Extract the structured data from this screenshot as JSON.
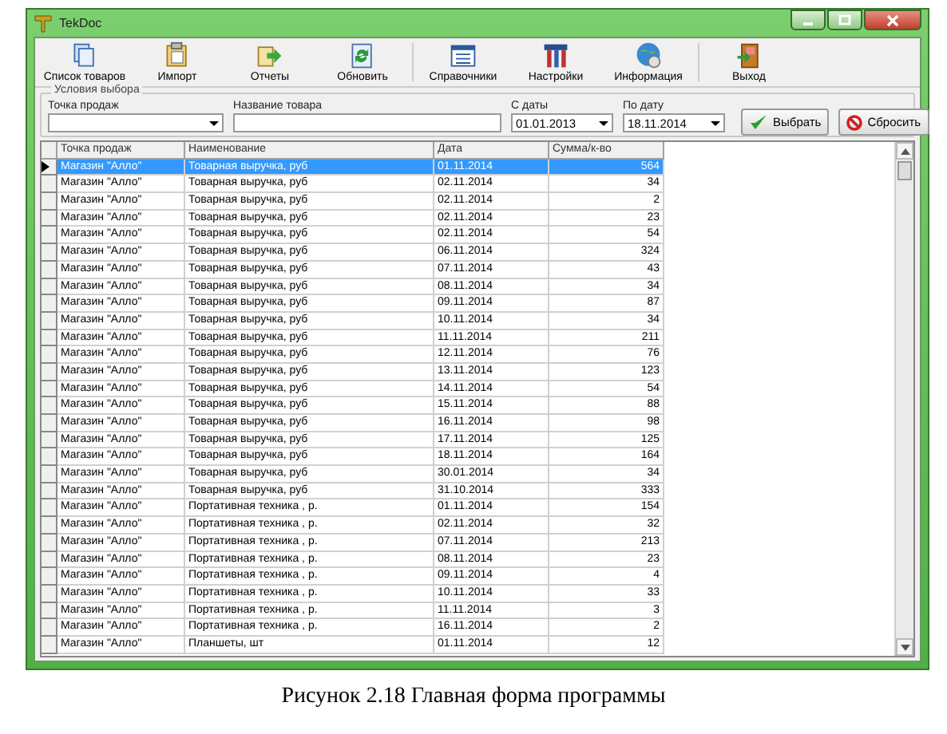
{
  "window": {
    "title": "TekDoc"
  },
  "toolbar": [
    {
      "label": "Список товаров",
      "kind": "list"
    },
    {
      "label": "Импорт",
      "kind": "import"
    },
    {
      "label": "Отчеты",
      "kind": "report"
    },
    {
      "label": "Обновить",
      "kind": "refresh"
    },
    {
      "label": "Справочники",
      "kind": "catalog"
    },
    {
      "label": "Настройки",
      "kind": "settings"
    },
    {
      "label": "Информация",
      "kind": "info"
    },
    {
      "label": "Выход",
      "kind": "exit"
    }
  ],
  "filter": {
    "title": "Условия выбора",
    "store_label": "Точка продаж",
    "product_label": "Название товара",
    "from_label": "С даты",
    "from_value": "01.01.2013",
    "to_label": "По дату",
    "to_value": "18.11.2014",
    "apply_button": "Выбрать",
    "reset_button": "Сбросить"
  },
  "table": {
    "columns": [
      "Точка продаж",
      "Наименование",
      "Дата",
      "Сумма/к-во"
    ],
    "rows": [
      {
        "cells": [
          "Магазин \"Алло\"",
          "Товарная выручка, руб",
          "01.11.2014",
          "564"
        ],
        "selected": true
      },
      {
        "cells": [
          "Магазин \"Алло\"",
          "Товарная выручка, руб",
          "02.11.2014",
          "34"
        ],
        "selected": false
      },
      {
        "cells": [
          "Магазин \"Алло\"",
          "Товарная выручка, руб",
          "02.11.2014",
          "2"
        ],
        "selected": false
      },
      {
        "cells": [
          "Магазин \"Алло\"",
          "Товарная выручка, руб",
          "02.11.2014",
          "23"
        ],
        "selected": false
      },
      {
        "cells": [
          "Магазин \"Алло\"",
          "Товарная выручка, руб",
          "02.11.2014",
          "54"
        ],
        "selected": false
      },
      {
        "cells": [
          "Магазин \"Алло\"",
          "Товарная выручка, руб",
          "06.11.2014",
          "324"
        ],
        "selected": false
      },
      {
        "cells": [
          "Магазин \"Алло\"",
          "Товарная выручка, руб",
          "07.11.2014",
          "43"
        ],
        "selected": false
      },
      {
        "cells": [
          "Магазин \"Алло\"",
          "Товарная выручка, руб",
          "08.11.2014",
          "34"
        ],
        "selected": false
      },
      {
        "cells": [
          "Магазин \"Алло\"",
          "Товарная выручка, руб",
          "09.11.2014",
          "87"
        ],
        "selected": false
      },
      {
        "cells": [
          "Магазин \"Алло\"",
          "Товарная выручка, руб",
          "10.11.2014",
          "34"
        ],
        "selected": false
      },
      {
        "cells": [
          "Магазин \"Алло\"",
          "Товарная выручка, руб",
          "11.11.2014",
          "211"
        ],
        "selected": false
      },
      {
        "cells": [
          "Магазин \"Алло\"",
          "Товарная выручка, руб",
          "12.11.2014",
          "76"
        ],
        "selected": false
      },
      {
        "cells": [
          "Магазин \"Алло\"",
          "Товарная выручка, руб",
          "13.11.2014",
          "123"
        ],
        "selected": false
      },
      {
        "cells": [
          "Магазин \"Алло\"",
          "Товарная выручка, руб",
          "14.11.2014",
          "54"
        ],
        "selected": false
      },
      {
        "cells": [
          "Магазин \"Алло\"",
          "Товарная выручка, руб",
          "15.11.2014",
          "88"
        ],
        "selected": false
      },
      {
        "cells": [
          "Магазин \"Алло\"",
          "Товарная выручка, руб",
          "16.11.2014",
          "98"
        ],
        "selected": false
      },
      {
        "cells": [
          "Магазин \"Алло\"",
          "Товарная выручка, руб",
          "17.11.2014",
          "125"
        ],
        "selected": false
      },
      {
        "cells": [
          "Магазин \"Алло\"",
          "Товарная выручка, руб",
          "18.11.2014",
          "164"
        ],
        "selected": false
      },
      {
        "cells": [
          "Магазин \"Алло\"",
          "Товарная выручка, руб",
          "30.01.2014",
          "34"
        ],
        "selected": false
      },
      {
        "cells": [
          "Магазин \"Алло\"",
          "Товарная выручка, руб",
          "31.10.2014",
          "333"
        ],
        "selected": false
      },
      {
        "cells": [
          "Магазин \"Алло\"",
          "Портативная техника , р.",
          "01.11.2014",
          "154"
        ],
        "selected": false
      },
      {
        "cells": [
          "Магазин \"Алло\"",
          "Портативная техника , р.",
          "02.11.2014",
          "32"
        ],
        "selected": false
      },
      {
        "cells": [
          "Магазин \"Алло\"",
          "Портативная техника , р.",
          "07.11.2014",
          "213"
        ],
        "selected": false
      },
      {
        "cells": [
          "Магазин \"Алло\"",
          "Портативная техника , р.",
          "08.11.2014",
          "23"
        ],
        "selected": false
      },
      {
        "cells": [
          "Магазин \"Алло\"",
          "Портативная техника , р.",
          "09.11.2014",
          "4"
        ],
        "selected": false
      },
      {
        "cells": [
          "Магазин \"Алло\"",
          "Портативная техника , р.",
          "10.11.2014",
          "33"
        ],
        "selected": false
      },
      {
        "cells": [
          "Магазин \"Алло\"",
          "Портативная техника , р.",
          "11.11.2014",
          "3"
        ],
        "selected": false
      },
      {
        "cells": [
          "Магазин \"Алло\"",
          "Портативная техника , р.",
          "16.11.2014",
          "2"
        ],
        "selected": false
      },
      {
        "cells": [
          "Магазин \"Алло\"",
          "Планшеты, шт",
          "01.11.2014",
          "12"
        ],
        "selected": false
      }
    ]
  },
  "caption": "Рисунок 2.18 Главная форма программы"
}
